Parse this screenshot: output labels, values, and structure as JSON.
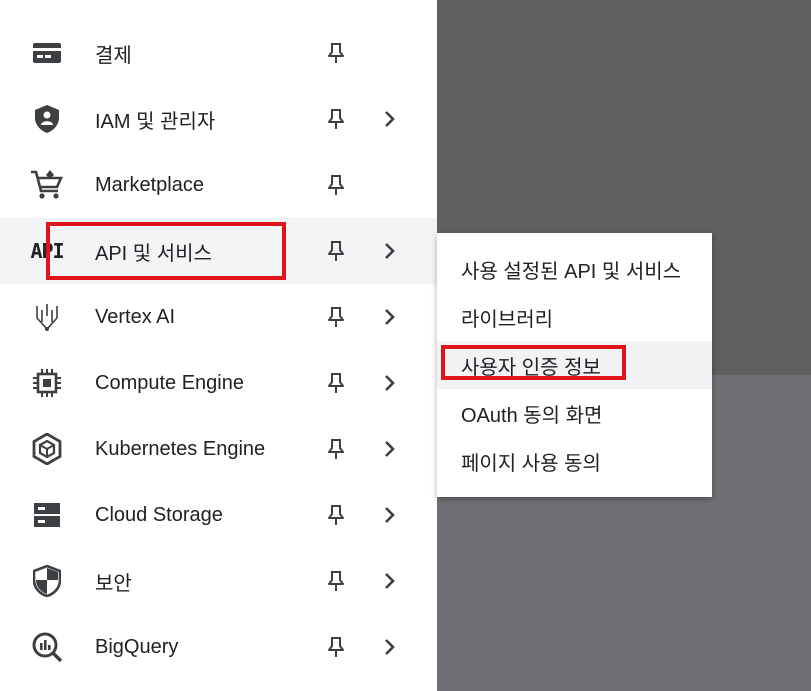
{
  "nav": {
    "items": [
      {
        "label": "결제",
        "icon": "billing-icon",
        "has_arrow": false
      },
      {
        "label": "IAM 및 관리자",
        "icon": "shield-person-icon",
        "has_arrow": true
      },
      {
        "label": "Marketplace",
        "icon": "cart-icon",
        "has_arrow": false
      },
      {
        "label": "API 및 서비스",
        "icon": "api-icon",
        "icon_text": "API",
        "has_arrow": true,
        "active": true
      },
      {
        "label": "Vertex AI",
        "icon": "vertex-ai-icon",
        "has_arrow": true
      },
      {
        "label": "Compute Engine",
        "icon": "chip-icon",
        "has_arrow": true
      },
      {
        "label": "Kubernetes Engine",
        "icon": "kubernetes-icon",
        "has_arrow": true
      },
      {
        "label": "Cloud Storage",
        "icon": "storage-icon",
        "has_arrow": true
      },
      {
        "label": "보안",
        "icon": "security-shield-icon",
        "has_arrow": true
      },
      {
        "label": "BigQuery",
        "icon": "bigquery-icon",
        "has_arrow": true
      }
    ]
  },
  "submenu": {
    "items": [
      {
        "label": "사용 설정된 API 및 서비스"
      },
      {
        "label": "라이브러리"
      },
      {
        "label": "사용자 인증 정보",
        "active": true
      },
      {
        "label": "OAuth 동의 화면"
      },
      {
        "label": "페이지 사용 동의"
      }
    ]
  },
  "colors": {
    "highlight": "#e0151c",
    "overlay": "#5f6062",
    "icon": "#3c4043"
  }
}
